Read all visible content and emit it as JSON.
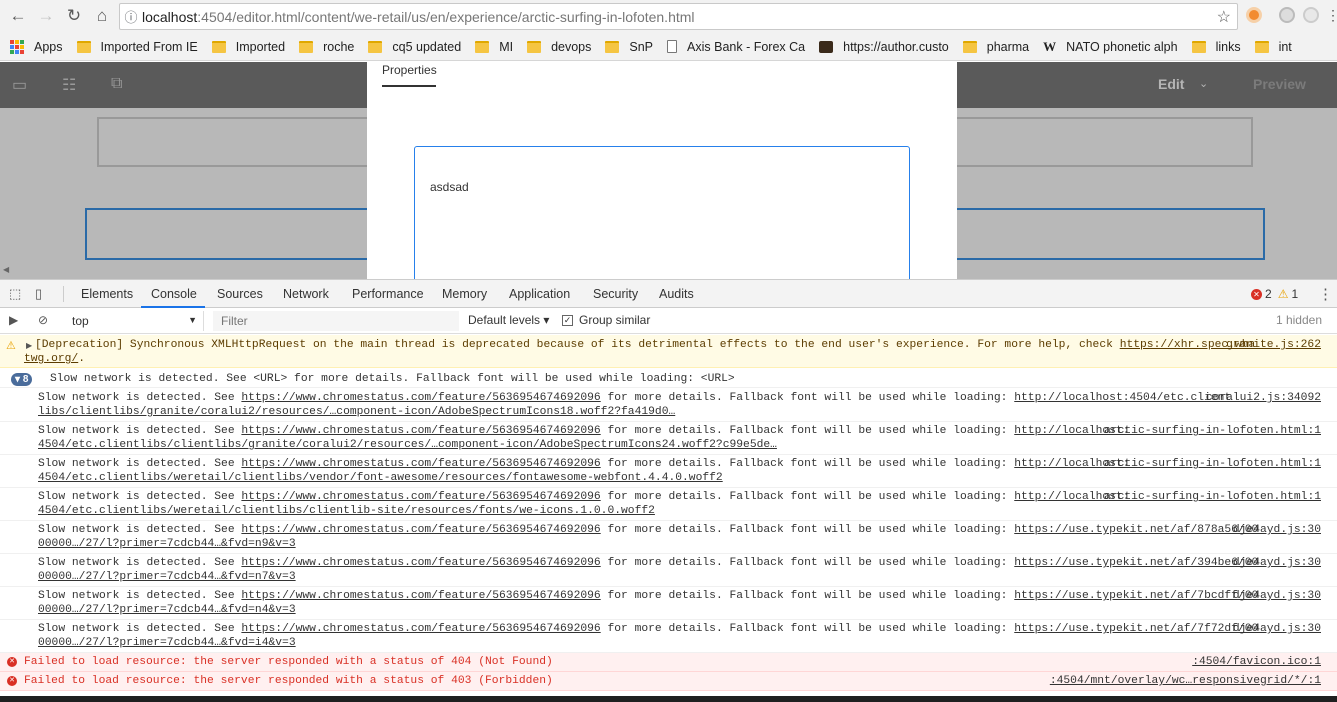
{
  "browser": {
    "url_host": "localhost",
    "url_port": ":4504",
    "url_path": "/editor.html/content/we-retail/us/en/experience/arctic-surfing-in-lofoten.html",
    "bookmarks": [
      {
        "label": "Apps",
        "icon": "apps-grid-icon"
      },
      {
        "label": "Imported From IE",
        "icon": "folder-icon"
      },
      {
        "label": "Imported",
        "icon": "folder-icon"
      },
      {
        "label": "roche",
        "icon": "folder-icon"
      },
      {
        "label": "cq5 updated",
        "icon": "folder-icon"
      },
      {
        "label": "MI",
        "icon": "folder-icon"
      },
      {
        "label": "devops",
        "icon": "folder-icon"
      },
      {
        "label": "SnP",
        "icon": "folder-icon"
      },
      {
        "label": "Axis Bank - Forex Ca",
        "icon": "page-icon"
      },
      {
        "label": "https://author.custo",
        "icon": "site-icon"
      },
      {
        "label": "pharma",
        "icon": "folder-icon"
      },
      {
        "label": "NATO phonetic alph",
        "icon": "wikipedia-icon"
      },
      {
        "label": "links",
        "icon": "folder-icon"
      },
      {
        "label": "int",
        "icon": "folder-icon"
      }
    ]
  },
  "editor": {
    "edit_label": "Edit",
    "preview_label": "Preview",
    "dialog": {
      "tab_label": "Properties",
      "rte_text": "asdsad"
    }
  },
  "devtools": {
    "tabs": [
      "Elements",
      "Console",
      "Sources",
      "Network",
      "Performance",
      "Memory",
      "Application",
      "Security",
      "Audits"
    ],
    "active_tab": "Console",
    "error_count": "2",
    "warning_count": "1",
    "context": "top",
    "filter_placeholder": "Filter",
    "levels_label": "Default levels",
    "group_similar_label": "Group similar",
    "hidden_label": "1 hidden",
    "messages": {
      "deprecation": {
        "text": "[Deprecation] Synchronous XMLHttpRequest on the main thread is deprecated because of its detrimental effects to the end user's experience. For more help, check ",
        "link1": "https://xhr.spec.wha",
        "link2": "twg.org/",
        "link2_tail": ".",
        "source": "granite.js:262"
      },
      "group": {
        "count": "8",
        "text": "Slow network is detected. See <URL> for more details. Fallback font will be used while loading: <URL>"
      },
      "slow_prefix": "Slow network is detected. See ",
      "slow_link": "https://www.chromestatus.com/feature/5636954674692096",
      "slow_mid": " for more details. Fallback font will be used while loading: ",
      "slow_items": [
        {
          "url": "http://localhost:4504/etc.client",
          "url2": "libs/clientlibs/granite/coralui2/resources/…component-icon/AdobeSpectrumIcons18.woff2?fa419d0…",
          "source": "coralui2.js:34092"
        },
        {
          "url": "http://localhost:",
          "url2": "4504/etc.clientlibs/clientlibs/granite/coralui2/resources/…component-icon/AdobeSpectrumIcons24.woff2?c99e5de…",
          "source": "arctic-surfing-in-lofoten.html:1"
        },
        {
          "url": "http://localhost:",
          "url2": "4504/etc.clientlibs/weretail/clientlibs/vendor/font-awesome/resources/fontawesome-webfont.4.4.0.woff2",
          "source": "arctic-surfing-in-lofoten.html:1"
        },
        {
          "url": "http://localhost:",
          "url2": "4504/etc.clientlibs/weretail/clientlibs/clientlib-site/resources/fonts/we-icons.1.0.0.woff2",
          "source": "arctic-surfing-in-lofoten.html:1"
        },
        {
          "url": "https://use.typekit.net/af/878a56/00",
          "url2": "00000…/27/l?primer=7cdcb44…&fvd=n9&v=3",
          "source": "dje4ayd.js:30"
        },
        {
          "url": "https://use.typekit.net/af/394be6/00",
          "url2": "00000…/27/l?primer=7cdcb44…&fvd=n7&v=3",
          "source": "dje4ayd.js:30"
        },
        {
          "url": "https://use.typekit.net/af/7bcdff/00",
          "url2": "00000…/27/l?primer=7cdcb44…&fvd=n4&v=3",
          "source": "dje4ayd.js:30"
        },
        {
          "url": "https://use.typekit.net/af/7f72df/00",
          "url2": "00000…/27/l?primer=7cdcb44…&fvd=i4&v=3",
          "source": "dje4ayd.js:30"
        }
      ],
      "errors": [
        {
          "text": "Failed to load resource: the server responded with a status of 404 (Not Found)",
          "source": ":4504/favicon.ico:1"
        },
        {
          "text": "Failed to load resource: the server responded with a status of 403 (Forbidden)",
          "source": ":4504/mnt/overlay/wc…responsivegrid/*/:1"
        }
      ]
    }
  },
  "colors": {
    "devtools_accent": "#1a73e8",
    "error_red": "#d93025",
    "warn_yellow": "#e8a100",
    "rte_border": "#2680eb"
  }
}
